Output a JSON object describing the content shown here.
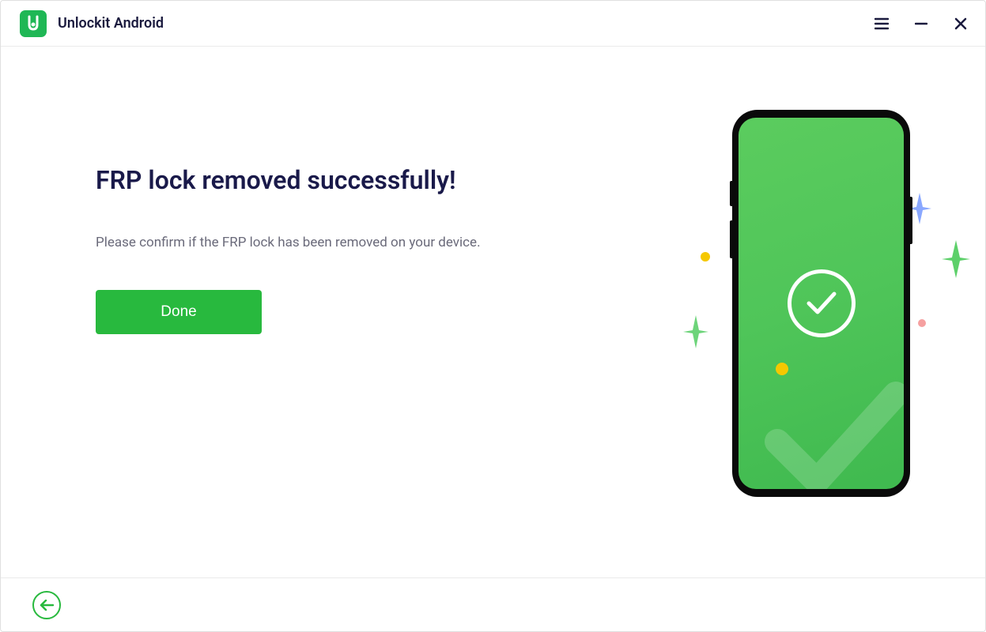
{
  "app": {
    "title": "Unlockit Android"
  },
  "main": {
    "heading": "FRP lock removed successfully!",
    "subtext": "Please confirm if the FRP lock has been removed on your device.",
    "done_label": "Done"
  }
}
